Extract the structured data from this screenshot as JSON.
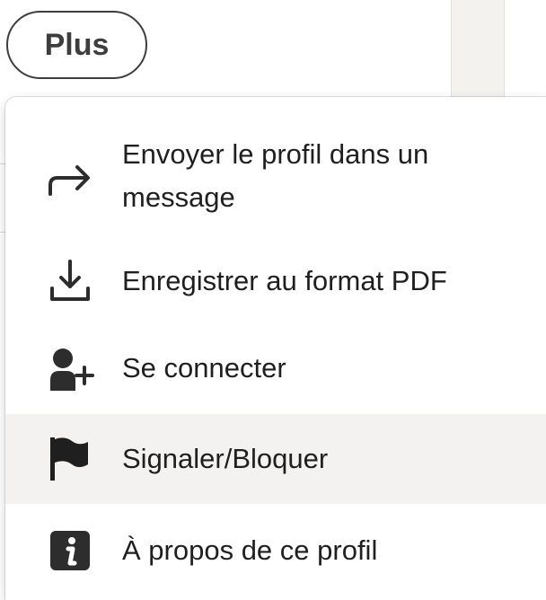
{
  "more_button": {
    "label": "Plus"
  },
  "menu": {
    "items": [
      {
        "label": "Envoyer le profil dans un message",
        "icon": "share-arrow-icon"
      },
      {
        "label": "Enregistrer au format PDF",
        "icon": "download-icon"
      },
      {
        "label": "Se connecter",
        "icon": "add-person-icon"
      },
      {
        "label": "Signaler/Bloquer",
        "icon": "flag-icon",
        "highlighted": true
      },
      {
        "label": "À propos de ce profil",
        "icon": "info-icon"
      }
    ]
  },
  "colors": {
    "highlight": "#f3f2f0",
    "text": "#1f1f1f",
    "icon": "#2d2d2d",
    "button_border": "#3d3d3d"
  }
}
